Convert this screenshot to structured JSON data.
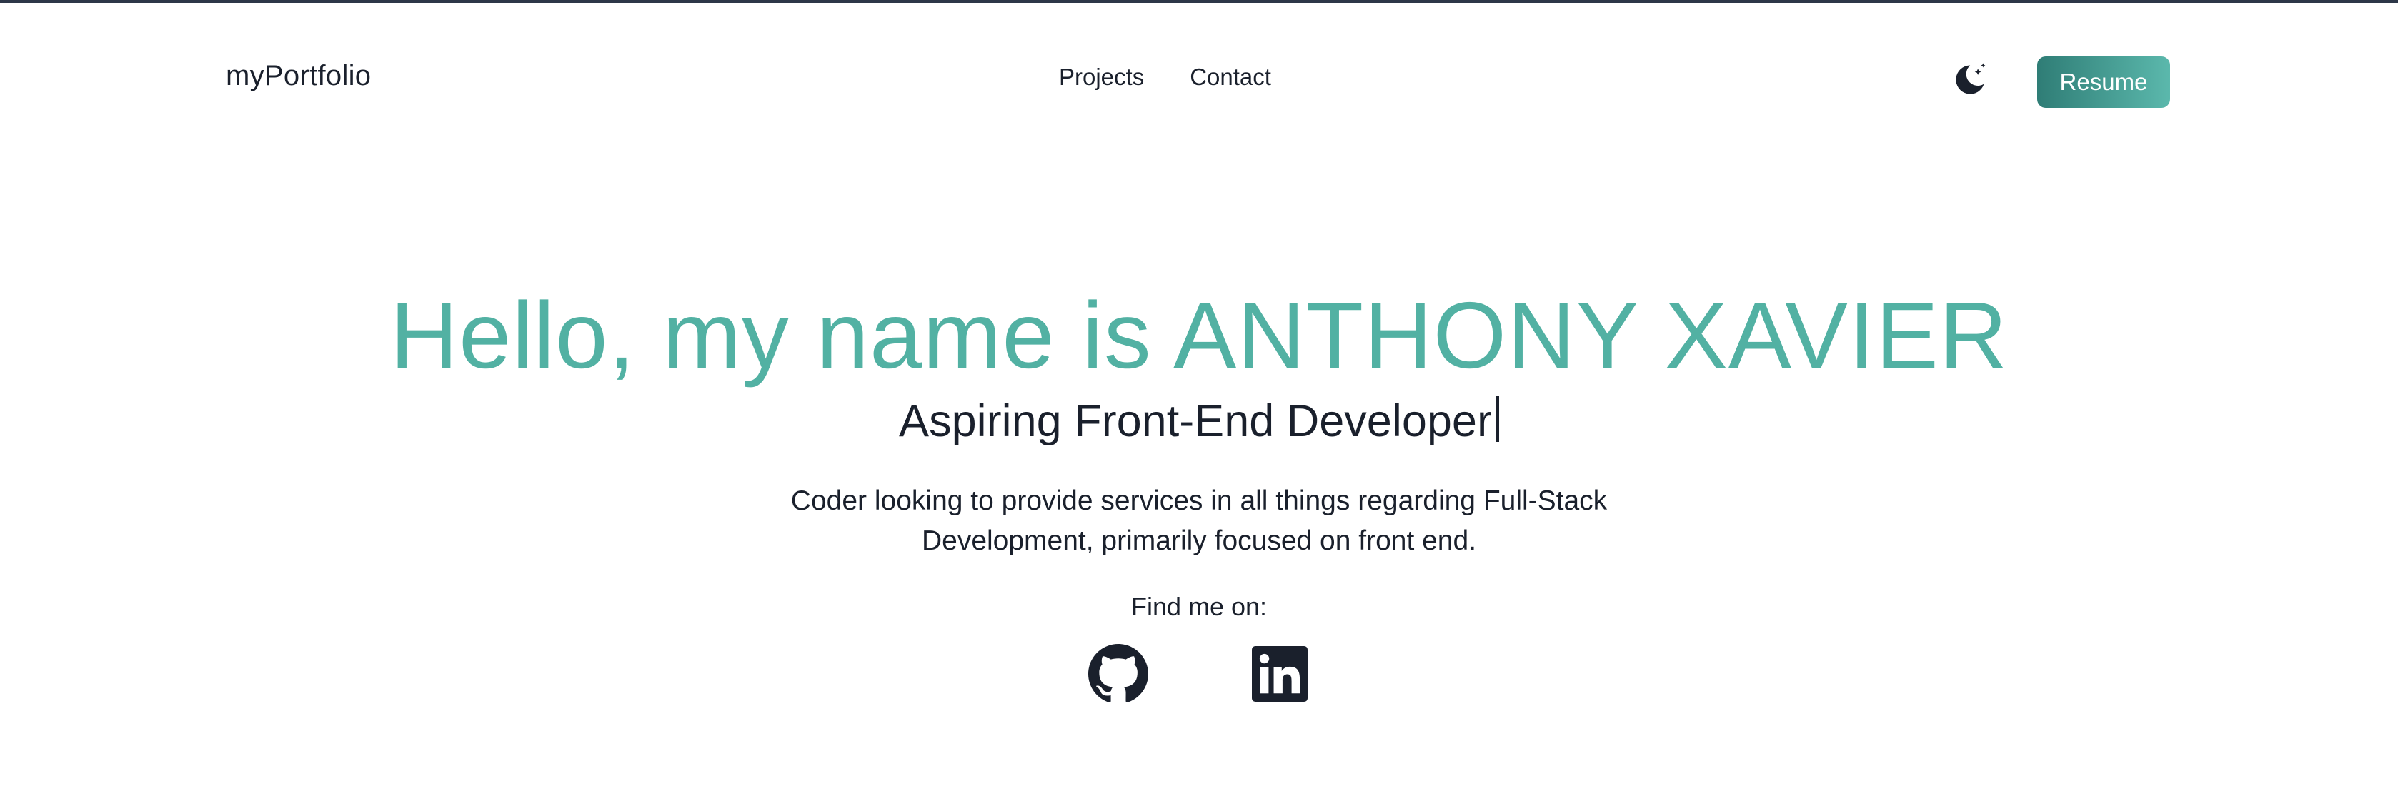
{
  "navbar": {
    "brand": "myPortfolio",
    "links": [
      {
        "label": "Projects"
      },
      {
        "label": "Contact"
      }
    ],
    "theme_toggle_icon": "moon-stars-icon",
    "resume_label": "Resume"
  },
  "hero": {
    "title": "Hello, my name is ANTHONY XAVIER",
    "subtitle": "Aspiring Front-End Developer",
    "description": "Coder looking to provide services in all things regarding Full-Stack Development, primarily focused on front end.",
    "find_me_label": "Find me on:",
    "socials": [
      {
        "icon": "github-icon"
      },
      {
        "icon": "linkedin-icon"
      }
    ]
  },
  "colors": {
    "accent": "#52b1a3",
    "text": "#1a202c",
    "button_gradient_start": "#2f7d76",
    "button_gradient_end": "#5bb8ac"
  }
}
